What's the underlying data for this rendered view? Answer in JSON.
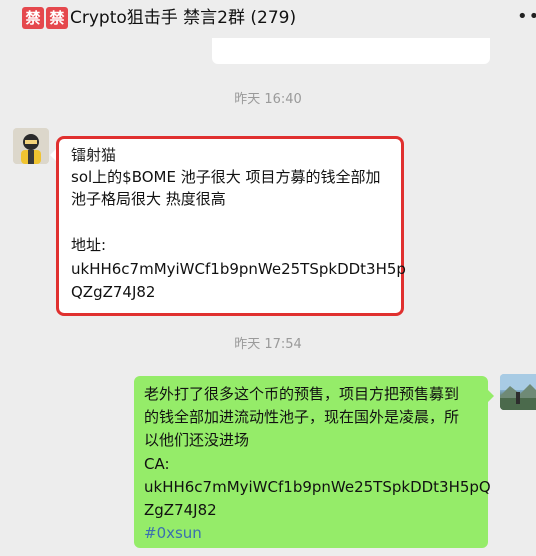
{
  "header": {
    "badges": [
      "禁",
      "禁"
    ],
    "title": "Crypto狙击手 禁言2群",
    "member_count": "(279)",
    "more_icon": "more-dots-icon"
  },
  "timestamps": [
    "昨天 16:40",
    "昨天 17:54"
  ],
  "messages": [
    {
      "sender": "镭射猫",
      "lines": [
        "sol上的$BOME 池子很大 项目方募的钱全部加",
        "池子格局很大 热度很高",
        "",
        "地址:",
        "ukHH6c7mMyiWCf1b9pnWe25TSpkDDt3H5p",
        "QZgZ74J82"
      ],
      "highlight_color": "#e0302f"
    },
    {
      "lines": [
        "老外打了很多这个币的预售，项目方把预售募到",
        "的钱全部加进流动性池子，现在国外是凌晨，所",
        "以他们还没进场",
        "CA:",
        "ukHH6c7mMyiWCf1b9pnWe25TSpkDDt3H5pQ",
        "ZgZ74J82"
      ],
      "hashtag": "#0xsun",
      "bubble_color": "#95ec69"
    }
  ]
}
